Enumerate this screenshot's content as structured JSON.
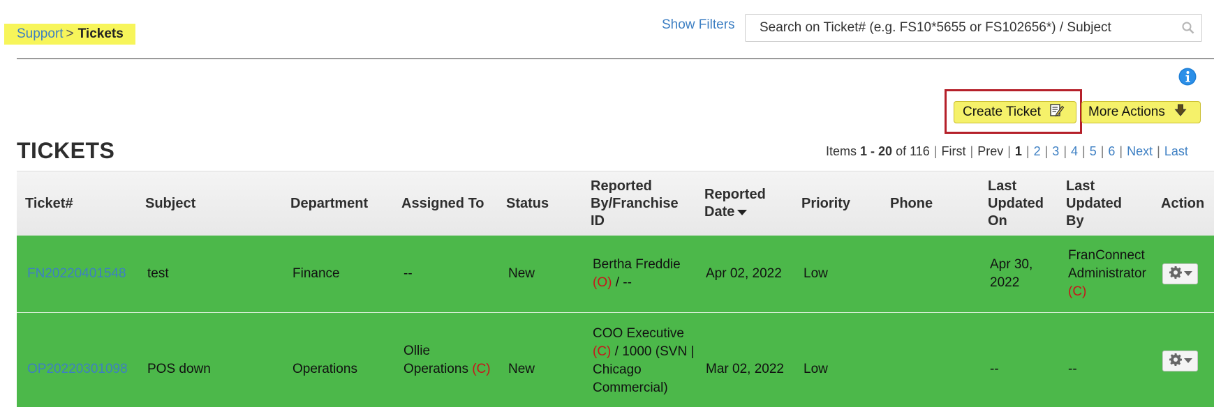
{
  "breadcrumb": {
    "parent": "Support",
    "separator": ">",
    "current": "Tickets"
  },
  "filters": {
    "show_filters_label": "Show Filters"
  },
  "search": {
    "placeholder": "Search on Ticket# (e.g. FS10*5655 or FS102656*) / Subject"
  },
  "actions": {
    "create_ticket": "Create Ticket",
    "more_actions": "More Actions"
  },
  "page_title": "TICKETS",
  "pagination": {
    "items_prefix": "Items",
    "range": "1 - 20",
    "of_label": "of",
    "total": "116",
    "first": "First",
    "prev": "Prev",
    "current_page": "1",
    "pages": [
      "2",
      "3",
      "4",
      "5",
      "6"
    ],
    "next": "Next",
    "last": "Last"
  },
  "table": {
    "headers": {
      "ticket": "Ticket#",
      "subject": "Subject",
      "department": "Department",
      "assigned_to": "Assigned To",
      "status": "Status",
      "reported_by_l1": "Reported",
      "reported_by_l2": "By/Franchise",
      "reported_by_l3": "ID",
      "reported_date_l1": "Reported",
      "reported_date_l2": "Date",
      "priority": "Priority",
      "phone": "Phone",
      "last_updated_on_l1": "Last",
      "last_updated_on_l2": "Updated",
      "last_updated_on_l3": "On",
      "last_updated_by_l1": "Last",
      "last_updated_by_l2": "Updated",
      "last_updated_by_l3": "By",
      "action": "Action"
    },
    "sort_indicator": "descending",
    "row_color": "#4cb84a",
    "rows": [
      {
        "ticket": "FN20220401548",
        "subject": "test",
        "department": "Finance",
        "assigned_to": "--",
        "assigned_to_tag": "",
        "status": "New",
        "reported_by_l1": "Bertha Freddie",
        "reported_by_tag": "(O)",
        "reported_by_rest": " / --",
        "reported_date": "Apr 02, 2022",
        "priority": "Low",
        "phone": "",
        "last_updated_on_l1": "Apr 30,",
        "last_updated_on_l2": "2022",
        "last_updated_by_l1": "FranConnect",
        "last_updated_by_l2": "Administrator",
        "last_updated_by_tag": "(C)"
      },
      {
        "ticket": "OP20220301098",
        "subject": "POS down",
        "department": "Operations",
        "assigned_to": "Ollie",
        "assigned_to_l2": "Operations",
        "assigned_to_tag": "(C)",
        "status": "New",
        "reported_by_l1": "COO Executive",
        "reported_by_tag": "(C)",
        "reported_by_rest": " / 1000 (SVN |",
        "reported_by_l3": "Chicago",
        "reported_by_l4": "Commercial)",
        "reported_date": "Mar 02, 2022",
        "priority": "Low",
        "phone": "",
        "last_updated_on": "--",
        "last_updated_by": "--"
      }
    ]
  },
  "icons": {
    "search": "magnifier-icon",
    "info": "info-icon",
    "create": "edit-note-icon",
    "more": "down-arrow-icon",
    "row_action": "gear-icon"
  },
  "colors": {
    "highlight": "#f7f55a",
    "link": "#3d7fc3",
    "alert_tag": "#c8151b",
    "focus_outline": "#b5202a"
  }
}
